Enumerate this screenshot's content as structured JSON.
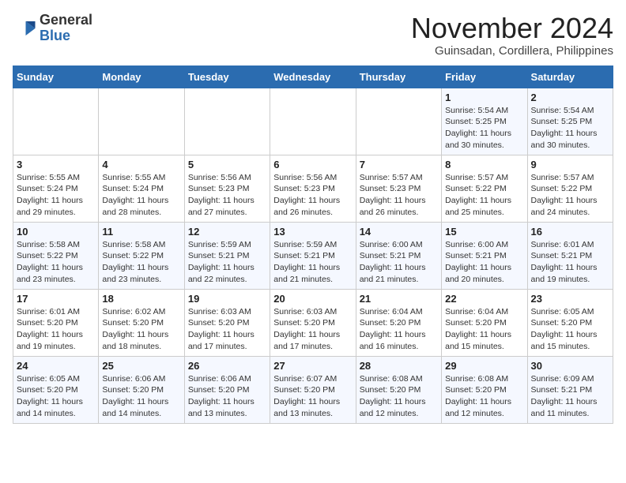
{
  "header": {
    "logo_general": "General",
    "logo_blue": "Blue",
    "month_year": "November 2024",
    "location": "Guinsadan, Cordillera, Philippines"
  },
  "weekdays": [
    "Sunday",
    "Monday",
    "Tuesday",
    "Wednesday",
    "Thursday",
    "Friday",
    "Saturday"
  ],
  "weeks": [
    [
      {
        "day": "",
        "info": ""
      },
      {
        "day": "",
        "info": ""
      },
      {
        "day": "",
        "info": ""
      },
      {
        "day": "",
        "info": ""
      },
      {
        "day": "",
        "info": ""
      },
      {
        "day": "1",
        "info": "Sunrise: 5:54 AM\nSunset: 5:25 PM\nDaylight: 11 hours\nand 30 minutes."
      },
      {
        "day": "2",
        "info": "Sunrise: 5:54 AM\nSunset: 5:25 PM\nDaylight: 11 hours\nand 30 minutes."
      }
    ],
    [
      {
        "day": "3",
        "info": "Sunrise: 5:55 AM\nSunset: 5:24 PM\nDaylight: 11 hours\nand 29 minutes."
      },
      {
        "day": "4",
        "info": "Sunrise: 5:55 AM\nSunset: 5:24 PM\nDaylight: 11 hours\nand 28 minutes."
      },
      {
        "day": "5",
        "info": "Sunrise: 5:56 AM\nSunset: 5:23 PM\nDaylight: 11 hours\nand 27 minutes."
      },
      {
        "day": "6",
        "info": "Sunrise: 5:56 AM\nSunset: 5:23 PM\nDaylight: 11 hours\nand 26 minutes."
      },
      {
        "day": "7",
        "info": "Sunrise: 5:57 AM\nSunset: 5:23 PM\nDaylight: 11 hours\nand 26 minutes."
      },
      {
        "day": "8",
        "info": "Sunrise: 5:57 AM\nSunset: 5:22 PM\nDaylight: 11 hours\nand 25 minutes."
      },
      {
        "day": "9",
        "info": "Sunrise: 5:57 AM\nSunset: 5:22 PM\nDaylight: 11 hours\nand 24 minutes."
      }
    ],
    [
      {
        "day": "10",
        "info": "Sunrise: 5:58 AM\nSunset: 5:22 PM\nDaylight: 11 hours\nand 23 minutes."
      },
      {
        "day": "11",
        "info": "Sunrise: 5:58 AM\nSunset: 5:22 PM\nDaylight: 11 hours\nand 23 minutes."
      },
      {
        "day": "12",
        "info": "Sunrise: 5:59 AM\nSunset: 5:21 PM\nDaylight: 11 hours\nand 22 minutes."
      },
      {
        "day": "13",
        "info": "Sunrise: 5:59 AM\nSunset: 5:21 PM\nDaylight: 11 hours\nand 21 minutes."
      },
      {
        "day": "14",
        "info": "Sunrise: 6:00 AM\nSunset: 5:21 PM\nDaylight: 11 hours\nand 21 minutes."
      },
      {
        "day": "15",
        "info": "Sunrise: 6:00 AM\nSunset: 5:21 PM\nDaylight: 11 hours\nand 20 minutes."
      },
      {
        "day": "16",
        "info": "Sunrise: 6:01 AM\nSunset: 5:21 PM\nDaylight: 11 hours\nand 19 minutes."
      }
    ],
    [
      {
        "day": "17",
        "info": "Sunrise: 6:01 AM\nSunset: 5:20 PM\nDaylight: 11 hours\nand 19 minutes."
      },
      {
        "day": "18",
        "info": "Sunrise: 6:02 AM\nSunset: 5:20 PM\nDaylight: 11 hours\nand 18 minutes."
      },
      {
        "day": "19",
        "info": "Sunrise: 6:03 AM\nSunset: 5:20 PM\nDaylight: 11 hours\nand 17 minutes."
      },
      {
        "day": "20",
        "info": "Sunrise: 6:03 AM\nSunset: 5:20 PM\nDaylight: 11 hours\nand 17 minutes."
      },
      {
        "day": "21",
        "info": "Sunrise: 6:04 AM\nSunset: 5:20 PM\nDaylight: 11 hours\nand 16 minutes."
      },
      {
        "day": "22",
        "info": "Sunrise: 6:04 AM\nSunset: 5:20 PM\nDaylight: 11 hours\nand 15 minutes."
      },
      {
        "day": "23",
        "info": "Sunrise: 6:05 AM\nSunset: 5:20 PM\nDaylight: 11 hours\nand 15 minutes."
      }
    ],
    [
      {
        "day": "24",
        "info": "Sunrise: 6:05 AM\nSunset: 5:20 PM\nDaylight: 11 hours\nand 14 minutes."
      },
      {
        "day": "25",
        "info": "Sunrise: 6:06 AM\nSunset: 5:20 PM\nDaylight: 11 hours\nand 14 minutes."
      },
      {
        "day": "26",
        "info": "Sunrise: 6:06 AM\nSunset: 5:20 PM\nDaylight: 11 hours\nand 13 minutes."
      },
      {
        "day": "27",
        "info": "Sunrise: 6:07 AM\nSunset: 5:20 PM\nDaylight: 11 hours\nand 13 minutes."
      },
      {
        "day": "28",
        "info": "Sunrise: 6:08 AM\nSunset: 5:20 PM\nDaylight: 11 hours\nand 12 minutes."
      },
      {
        "day": "29",
        "info": "Sunrise: 6:08 AM\nSunset: 5:20 PM\nDaylight: 11 hours\nand 12 minutes."
      },
      {
        "day": "30",
        "info": "Sunrise: 6:09 AM\nSunset: 5:21 PM\nDaylight: 11 hours\nand 11 minutes."
      }
    ]
  ]
}
